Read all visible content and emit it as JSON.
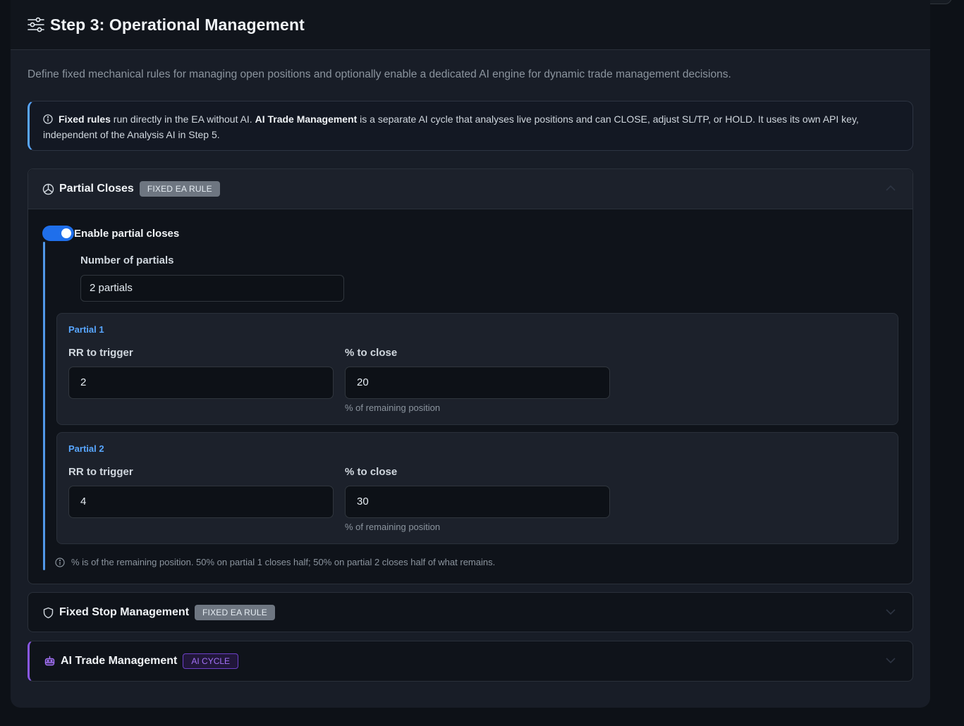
{
  "header": {
    "title": "Step 3: Operational Management",
    "icon": "sliders-icon"
  },
  "description": "Define fixed mechanical rules for managing open positions and optionally enable a dedicated AI engine for dynamic trade management decisions.",
  "info": {
    "fixed_rules_bold": "Fixed rules",
    "text1": " run directly in the EA without AI. ",
    "ai_bold": "AI Trade Management",
    "text2": " is a separate AI cycle that analyses live positions and can CLOSE, adjust SL/TP, or HOLD. It uses its own API key, independent of the Analysis AI in Step 5."
  },
  "partial_closes": {
    "title": "Partial Closes",
    "badge": "FIXED EA RULE",
    "toggle_label": "Enable partial closes",
    "toggle_on": true,
    "number_label": "Number of partials",
    "number_value": "2 partials",
    "partials": [
      {
        "title": "Partial 1",
        "rr_label": "RR to trigger",
        "rr_value": "2",
        "pct_label": "% to close",
        "pct_value": "20",
        "pct_help": "% of remaining position"
      },
      {
        "title": "Partial 2",
        "rr_label": "RR to trigger",
        "rr_value": "4",
        "pct_label": "% to close",
        "pct_value": "30",
        "pct_help": "% of remaining position"
      }
    ],
    "footnote": "% is of the remaining position. 50% on partial 1 closes half; 50% on partial 2 closes half of what remains."
  },
  "fixed_stop": {
    "title": "Fixed Stop Management",
    "badge": "FIXED EA RULE"
  },
  "ai_trade": {
    "title": "AI Trade Management",
    "badge": "AI CYCLE"
  },
  "colors": {
    "accent": "#1f6feb",
    "link": "#58a6ff",
    "ai_purple": "#8957e5"
  }
}
